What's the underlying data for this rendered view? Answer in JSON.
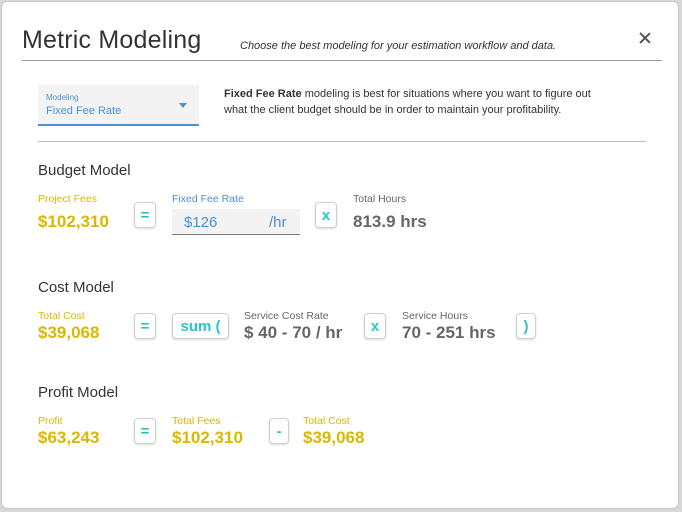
{
  "title": "Metric Modeling",
  "subtitle": "Choose the best modeling for your estimation workflow and data.",
  "modeling": {
    "label": "Modeling",
    "value": "Fixed Fee Rate",
    "desc_bold": "Fixed Fee Rate",
    "desc_rest": " modeling is best for situations where you want to figure out what the client budget should be in order to maintain your profitability."
  },
  "budget": {
    "heading": "Budget Model",
    "project_fees_label": "Project Fees",
    "project_fees_value": "$102,310",
    "equals": "=",
    "rate_label": "Fixed Fee Rate",
    "rate_value": "$126",
    "rate_unit": "/hr",
    "times": "x",
    "hours_label": "Total Hours",
    "hours_value": "813.9 hrs"
  },
  "cost": {
    "heading": "Cost Model",
    "total_cost_label": "Total Cost",
    "total_cost_value": "$39,068",
    "equals": "=",
    "sum": "sum (",
    "rate_label": "Service Cost Rate",
    "rate_value": "$ 40 - 70 / hr",
    "times": "x",
    "hours_label": "Service Hours",
    "hours_value": "70 - 251 hrs",
    "close_paren": ")"
  },
  "profit": {
    "heading": "Profit Model",
    "profit_label": "Profit",
    "profit_value": "$63,243",
    "equals": "=",
    "fees_label": "Total Fees",
    "fees_value": "$102,310",
    "minus": "-",
    "cost_label": "Total Cost",
    "cost_value": "$39,068"
  }
}
